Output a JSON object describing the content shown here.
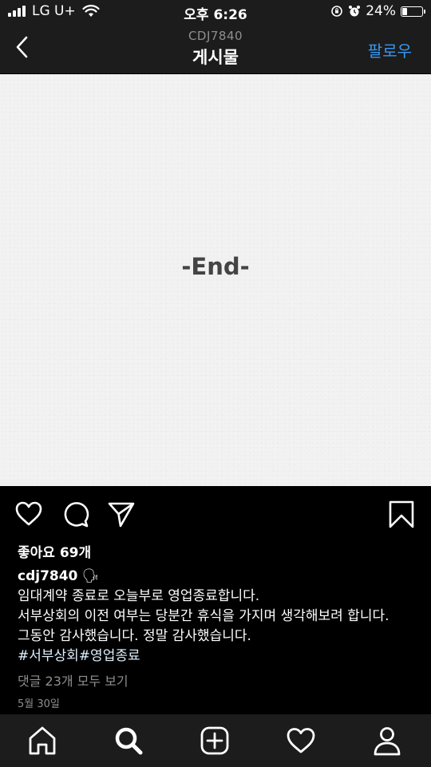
{
  "status_bar": {
    "carrier": "LG U+",
    "time": "오후 6:26",
    "battery_percent": "24%",
    "battery_level": 0.24
  },
  "header": {
    "subtitle": "CDJ7840",
    "title": "게시물",
    "follow_label": "팔로우",
    "back_icon": "chevron-left-icon"
  },
  "post": {
    "image_text": "-End-",
    "likes": "좋아요 69개",
    "username": "cdj7840",
    "emoji": "🗣",
    "caption_lines": [
      "임대계약 종료로 오늘부로 영업종료합니다.",
      "서부상회의 이전 여부는 당분간 휴식을 가지며 생각해보려 합니다.",
      "그동안 감사했습니다. 정말 감사했습니다."
    ],
    "hashtags": "#서부상회#영업종료",
    "comments_link": "댓글 23개 모두 보기",
    "date": "5월 30일"
  },
  "actions": {
    "icons": [
      "heart-icon",
      "comment-icon",
      "share-icon",
      "bookmark-icon"
    ]
  },
  "bottom_nav": {
    "icons": [
      "home-icon",
      "search-icon",
      "add-post-icon",
      "activity-heart-icon",
      "profile-icon"
    ]
  },
  "colors": {
    "accent": "#3897f0",
    "background": "#000000",
    "bar": "#1c1c1c",
    "muted": "#8e8e8e"
  }
}
